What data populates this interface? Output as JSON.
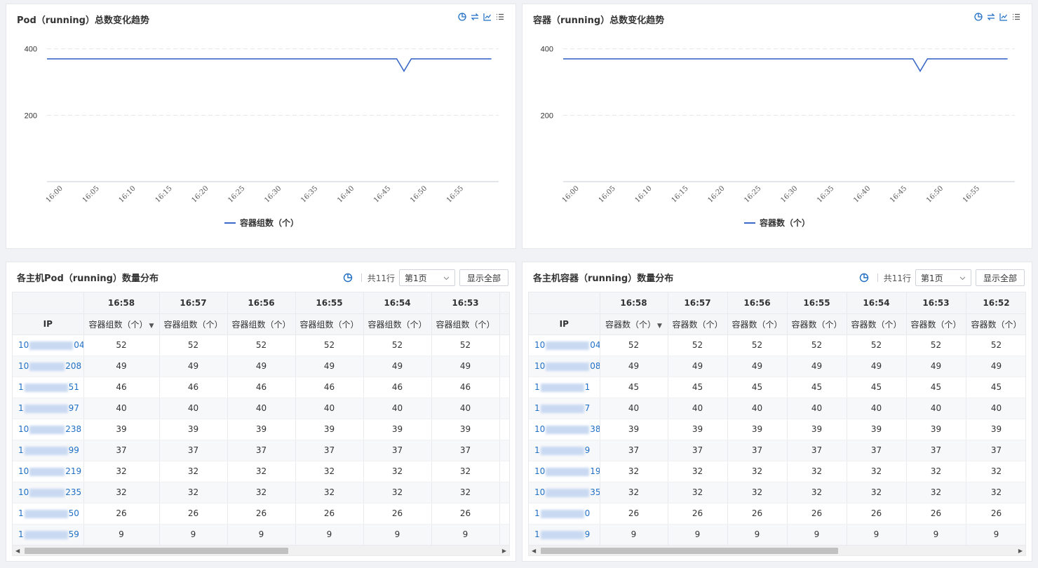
{
  "colors": {
    "accent": "#1f6fc5",
    "line": "#3a68c8",
    "grid": "#e6e6e6"
  },
  "tool_icons": [
    "pie-chart-icon",
    "switch-icon",
    "line-chart-icon",
    "list-icon"
  ],
  "pod_chart": {
    "title": "Pod（running）总数变化趋势",
    "legend": "容器组数（个）"
  },
  "container_chart": {
    "title": "容器（running）总数变化趋势",
    "legend": "容器数（个）"
  },
  "chart_data": [
    {
      "type": "line",
      "title": "Pod（running）总数变化趋势",
      "xlabel": "",
      "ylabel": "",
      "ylim": [
        0,
        450
      ],
      "yticks": [
        200,
        400
      ],
      "grid": true,
      "legend_position": "bottom",
      "x_ticks": [
        "16:00",
        "16:05",
        "16:10",
        "16:15",
        "16:20",
        "16:25",
        "16:30",
        "16:35",
        "16:40",
        "16:45",
        "16:50",
        "16:55"
      ],
      "series": [
        {
          "name": "容器组数（个）",
          "x": [
            "15:58",
            "16:46",
            "16:47",
            "16:48",
            "16:59"
          ],
          "y": [
            370,
            370,
            333,
            370,
            370
          ]
        }
      ]
    },
    {
      "type": "line",
      "title": "容器（running）总数变化趋势",
      "xlabel": "",
      "ylabel": "",
      "ylim": [
        0,
        450
      ],
      "yticks": [
        200,
        400
      ],
      "grid": true,
      "legend_position": "bottom",
      "x_ticks": [
        "16:00",
        "16:05",
        "16:10",
        "16:15",
        "16:20",
        "16:25",
        "16:30",
        "16:35",
        "16:40",
        "16:45",
        "16:50",
        "16:55"
      ],
      "series": [
        {
          "name": "容器数（个）",
          "x": [
            "15:58",
            "16:46",
            "16:47",
            "16:48",
            "16:59"
          ],
          "y": [
            370,
            370,
            333,
            370,
            370
          ]
        }
      ]
    }
  ],
  "pod_table": {
    "title": "各主机Pod（running）数量分布",
    "total": "共11行",
    "page": "第1页",
    "show_all": "显示全部",
    "ip_header": "IP",
    "times": [
      "16:58",
      "16:57",
      "16:56",
      "16:55",
      "16:54",
      "16:53",
      ""
    ],
    "metric": "容器组数（个）",
    "metric_partial": "容",
    "rows": [
      {
        "ip_prefix": "10",
        "ip_suffix": "04",
        "values": [
          52,
          52,
          52,
          52,
          52,
          52
        ]
      },
      {
        "ip_prefix": "10",
        "ip_suffix": "208",
        "values": [
          49,
          49,
          49,
          49,
          49,
          49
        ]
      },
      {
        "ip_prefix": "1",
        "ip_suffix": "51",
        "values": [
          46,
          46,
          46,
          46,
          46,
          46
        ]
      },
      {
        "ip_prefix": "1",
        "ip_suffix": "97",
        "values": [
          40,
          40,
          40,
          40,
          40,
          40
        ]
      },
      {
        "ip_prefix": "10",
        "ip_suffix": "238",
        "values": [
          39,
          39,
          39,
          39,
          39,
          39
        ]
      },
      {
        "ip_prefix": "1",
        "ip_suffix": "99",
        "values": [
          37,
          37,
          37,
          37,
          37,
          37
        ]
      },
      {
        "ip_prefix": "10",
        "ip_suffix": "219",
        "values": [
          32,
          32,
          32,
          32,
          32,
          32
        ]
      },
      {
        "ip_prefix": "10",
        "ip_suffix": "235",
        "values": [
          32,
          32,
          32,
          32,
          32,
          32
        ]
      },
      {
        "ip_prefix": "1",
        "ip_suffix": "50",
        "values": [
          26,
          26,
          26,
          26,
          26,
          26
        ]
      },
      {
        "ip_prefix": "1",
        "ip_suffix": "59",
        "values": [
          9,
          9,
          9,
          9,
          9,
          9
        ]
      }
    ]
  },
  "container_table": {
    "title": "各主机容器（running）数量分布",
    "total": "共11行",
    "page": "第1页",
    "show_all": "显示全部",
    "ip_header": "IP",
    "times": [
      "16:58",
      "16:57",
      "16:56",
      "16:55",
      "16:54",
      "16:53",
      "16:52"
    ],
    "metric": "容器数（个）",
    "rows": [
      {
        "ip_prefix": "10",
        "ip_suffix": "04",
        "values": [
          52,
          52,
          52,
          52,
          52,
          52,
          52
        ]
      },
      {
        "ip_prefix": "10",
        "ip_suffix": "08",
        "values": [
          49,
          49,
          49,
          49,
          49,
          49,
          49
        ]
      },
      {
        "ip_prefix": "1",
        "ip_suffix": "1",
        "values": [
          45,
          45,
          45,
          45,
          45,
          45,
          45
        ]
      },
      {
        "ip_prefix": "1",
        "ip_suffix": "7",
        "values": [
          40,
          40,
          40,
          40,
          40,
          40,
          40
        ]
      },
      {
        "ip_prefix": "10",
        "ip_suffix": "38",
        "values": [
          39,
          39,
          39,
          39,
          39,
          39,
          39
        ]
      },
      {
        "ip_prefix": "1",
        "ip_suffix": "9",
        "values": [
          37,
          37,
          37,
          37,
          37,
          37,
          37
        ]
      },
      {
        "ip_prefix": "10",
        "ip_suffix": "19",
        "values": [
          32,
          32,
          32,
          32,
          32,
          32,
          32
        ]
      },
      {
        "ip_prefix": "10",
        "ip_suffix": "35",
        "values": [
          32,
          32,
          32,
          32,
          32,
          32,
          32
        ]
      },
      {
        "ip_prefix": "1",
        "ip_suffix": "0",
        "values": [
          26,
          26,
          26,
          26,
          26,
          26,
          26
        ]
      },
      {
        "ip_prefix": "1",
        "ip_suffix": "9",
        "values": [
          9,
          9,
          9,
          9,
          9,
          9,
          9
        ]
      }
    ]
  }
}
